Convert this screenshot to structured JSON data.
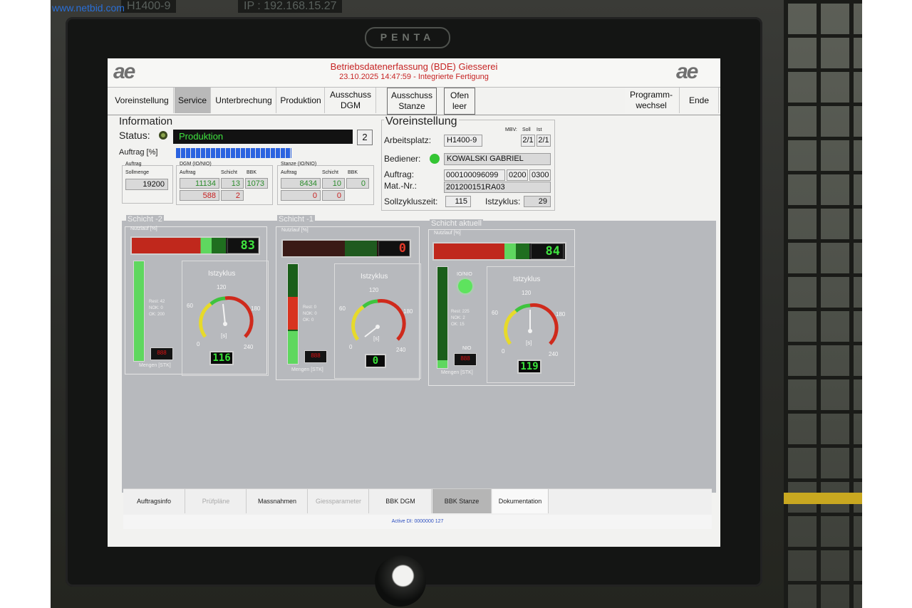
{
  "watermark": "www.netbid.com",
  "top_strip": [
    "H1400-9",
    "IP : 192.168.15.27"
  ],
  "bezel_logo": "PENTA",
  "header": {
    "logo_left": "ae",
    "logo_right": "ae",
    "title": "Betriebsdatenerfassung (BDE) Giesserei",
    "subtitle": "23.10.2025 14:47:59 - Integrierte Fertigung"
  },
  "menu": {
    "voreinstellung": "Voreinstellung",
    "service": "Service",
    "unterbrechung": "Unterbrechung",
    "produktion": "Produktion",
    "ausschuss_dgm": [
      "Ausschuss",
      "DGM"
    ],
    "ausschuss_stanze": [
      "Ausschuss",
      "Stanze"
    ],
    "ofen_leer": [
      "Ofen",
      "leer"
    ],
    "programmwechsel": [
      "Programm-",
      "wechsel"
    ],
    "ende": "Ende"
  },
  "information": {
    "title": "Information",
    "status_label": "Status:",
    "status_value": "Produktion",
    "status_count": "2",
    "auftrag_label": "Auftrag [%]",
    "auftrag_progress": 0.62,
    "auftrag_box": {
      "title": "Auftrag",
      "sub": "Sollmenge",
      "value": "19200"
    },
    "dgm_box": {
      "title": "DGM (IO/NIO)",
      "cols": [
        "Auftrag",
        "Schicht",
        "BBK"
      ],
      "io": [
        "11134",
        "13",
        "1073"
      ],
      "nio": [
        "588",
        "2"
      ]
    },
    "stanze_box": {
      "title": "Stanze (IO/NIO)",
      "cols": [
        "Auftrag",
        "Schicht",
        "BBK"
      ],
      "io": [
        "8434",
        "10",
        "0"
      ],
      "nio": [
        "0",
        "0"
      ]
    }
  },
  "voreinstellung": {
    "title": "Voreinstellung",
    "mbv_label": "MBV:",
    "soll_label": "Soll",
    "ist_label": "Ist",
    "arbeitsplatz_label": "Arbeitsplatz:",
    "arbeitsplatz": "H1400-9",
    "mbv_soll": "2/1",
    "mbv_ist": "2/1",
    "bediener_label": "Bediener:",
    "bediener": "KOWALSKI GABRIEL",
    "auftrag_label": "Auftrag:",
    "auftrag": [
      "000100096099",
      "0200",
      "0300"
    ],
    "matnr_label": "Mat.-Nr.:",
    "matnr": "201200151RA03",
    "sollzyklus_label": "Sollzykluszeit:",
    "sollzyklus": "115",
    "istzyklus_label": "Istzyklus:",
    "istzyklus": "29"
  },
  "shifts": [
    {
      "title": "Schicht -2",
      "nutzlauf_label": "Nutzlauf [%]",
      "nutzlauf": "83",
      "nutzlauf_fraction": 0.83,
      "legend": [
        "Rest: 42",
        "NOK: 0",
        "OK: 200"
      ],
      "nio_label": "NIO",
      "nio_value": "888",
      "mengen": "Mengen [STK]",
      "istzyklus": "Istzyklus",
      "scale": [
        "0",
        "60",
        "120",
        "180",
        "240"
      ],
      "unit": "[s]",
      "digit": "116",
      "fill_green": 1.0,
      "fill_red": 0.0
    },
    {
      "title": "Schicht -1",
      "nutzlauf_label": "Nutzlauf [%]",
      "nutzlauf": "0",
      "nutzlauf_fraction": 0.0,
      "legend": [
        "Rest: 0",
        "NOK: 0",
        "OK: 0"
      ],
      "nio_label": "NIO",
      "nio_value": "888",
      "mengen": "Mengen [STK]",
      "istzyklus": "Istzyklus",
      "scale": [
        "0",
        "60",
        "120",
        "180",
        "240"
      ],
      "unit": "[s]",
      "digit": "0",
      "fill_green": 0.33,
      "fill_red": 0.33
    },
    {
      "title": "Schicht aktuell",
      "nutzlauf_label": "Nutzlauf [%]",
      "nutzlauf": "84",
      "nutzlauf_fraction": 0.84,
      "legend": [
        "Rest: 225",
        "NOK: 2",
        "OK: 15"
      ],
      "ionio": "IO/NIO",
      "nio_label": "NIO",
      "nio_value": "888",
      "mengen": "Mengen [STK]",
      "istzyklus": "Istzyklus",
      "scale": [
        "0",
        "60",
        "120",
        "180",
        "240"
      ],
      "unit": "[s]",
      "digit": "119",
      "fill_green": 0.08,
      "fill_red": 0.0
    }
  ],
  "bottom_menu": [
    "Auftragsinfo",
    "Prüfpläne",
    "Massnahmen",
    "Giessparameter",
    "BBK DGM",
    "BBK Stanze",
    "Dokumentation"
  ],
  "status_bar": "Active DI: 0000000 127",
  "colors": {
    "header_red": "#c62424",
    "bar_red": "#c0281c",
    "bar_green": "#5fd75f",
    "digit_green": "#39e339",
    "panel_grey": "#b7b9bd"
  }
}
